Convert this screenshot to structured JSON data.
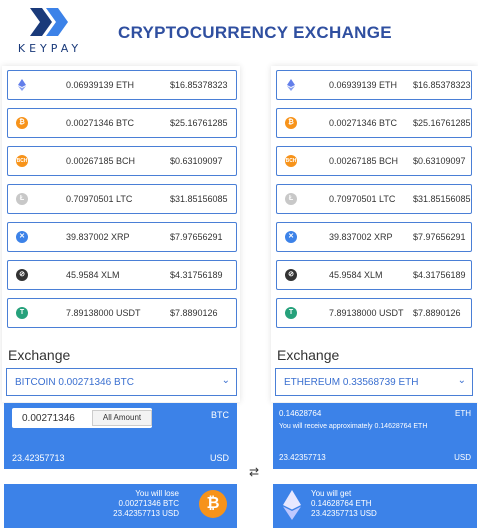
{
  "brand": {
    "name": "KEYPAY"
  },
  "header": {
    "title": "CRYPTOCURRENCY EXCHANGE"
  },
  "coins": [
    {
      "symbol": "ETH",
      "amount": "0.06939139 ETH",
      "usd": "$16.85378323",
      "icon": "ethereum-icon",
      "color": "#627eea"
    },
    {
      "symbol": "BTC",
      "amount": "0.00271346 BTC",
      "usd": "$25.16761285",
      "icon": "bitcoin-icon",
      "color": "#f7931a"
    },
    {
      "symbol": "BCH",
      "amount": "0.00267185 BCH",
      "usd": "$0.63109097",
      "icon": "bitcoin-cash-icon",
      "color": "#f7931a"
    },
    {
      "symbol": "LTC",
      "amount": "0.70970501 LTC",
      "usd": "$31.85156085",
      "icon": "litecoin-icon",
      "color": "#b8b8b8"
    },
    {
      "symbol": "XRP",
      "amount": "39.837002 XRP",
      "usd": "$7.97656291",
      "icon": "ripple-icon",
      "color": "#3c82e8"
    },
    {
      "symbol": "XLM",
      "amount": "45.9584 XLM",
      "usd": "$4.31756189",
      "icon": "stellar-icon",
      "color": "#333333"
    },
    {
      "symbol": "USDT",
      "amount": "7.89138000 USDT",
      "usd": "$7.8890126",
      "icon": "tether-icon",
      "color": "#26a17b"
    }
  ],
  "left": {
    "exchange_label": "Exchange",
    "select_value": "BITCOIN 0.00271346 BTC",
    "amount_value": "0.00271346",
    "all_amount_label": "All Amount",
    "coin_code": "BTC",
    "usd_value": "23.42357713",
    "usd_code": "USD",
    "lose_line1": "You will lose",
    "lose_line2": "0.00271346 BTC",
    "lose_line3": "23.42357713 USD"
  },
  "right": {
    "exchange_label": "Exchange",
    "select_value": "ETHEREUM 0.33568739 ETH",
    "amount_value": "0.14628764",
    "coin_code": "ETH",
    "receive_text": "You will receive approximately 0.14628764 ETH",
    "usd_value": "23.42357713",
    "usd_code": "USD",
    "get_line1": "You will get",
    "get_line2": "0.14628764 ETH",
    "get_line3": "23.42357713 USD"
  },
  "colors": {
    "accent": "#3c82e8",
    "title": "#2f4fa0",
    "border": "#4a7fd6"
  }
}
